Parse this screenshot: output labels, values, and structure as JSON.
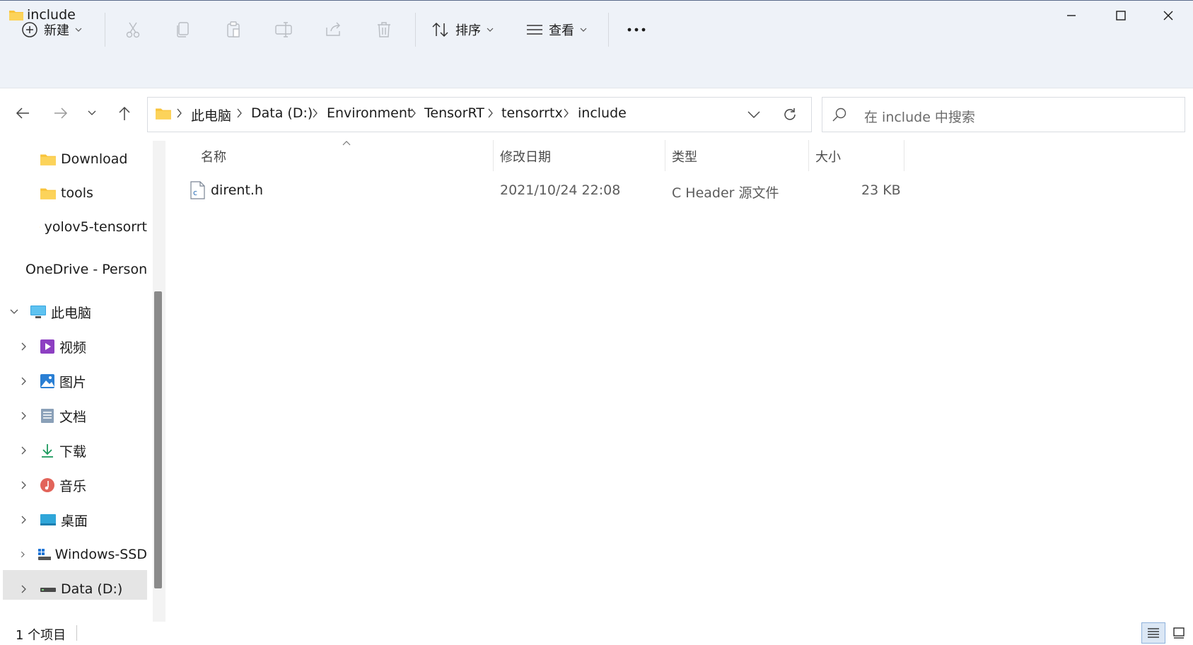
{
  "window": {
    "title": "include"
  },
  "toolbar": {
    "new_label": "新建",
    "sort_label": "排序",
    "view_label": "查看",
    "more_label": "···"
  },
  "address": {
    "crumbs": [
      "此电脑",
      "Data (D:)",
      "Environment",
      "TensorRT",
      "tensorrtx",
      "include"
    ]
  },
  "search": {
    "placeholder": "在 include 中搜索"
  },
  "sidebar": {
    "items": [
      {
        "label": "Download"
      },
      {
        "label": "tools"
      },
      {
        "label": "yolov5-tensorrt"
      },
      {
        "label": "OneDrive - Personal"
      },
      {
        "label": "此电脑"
      },
      {
        "label": "视频"
      },
      {
        "label": "图片"
      },
      {
        "label": "文档"
      },
      {
        "label": "下载"
      },
      {
        "label": "音乐"
      },
      {
        "label": "桌面"
      },
      {
        "label": "Windows-SSD"
      },
      {
        "label": "Data (D:)"
      }
    ]
  },
  "columns": {
    "name": "名称",
    "modified": "修改日期",
    "type": "类型",
    "size": "大小"
  },
  "files": [
    {
      "name": "dirent.h",
      "modified": "2021/10/24 22:08",
      "type": "C Header 源文件",
      "size": "23 KB"
    }
  ],
  "status": {
    "count_text": "1 个项目"
  },
  "colors": {
    "accent": "#0067c0",
    "folder": "#f8c33a",
    "toolbar_bg": "#eef2f8"
  }
}
